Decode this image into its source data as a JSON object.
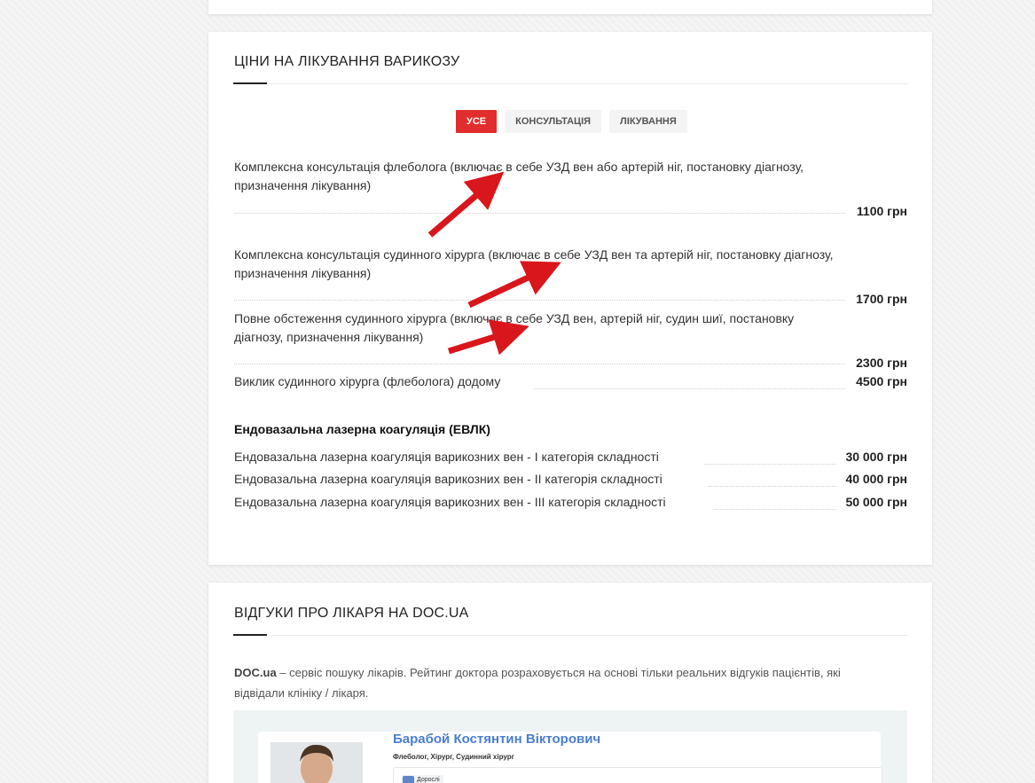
{
  "prices_section": {
    "title": "ЦІНИ НА ЛІКУВАННЯ ВАРИКОЗУ",
    "tabs": [
      {
        "label": "УСЕ",
        "active": true
      },
      {
        "label": "КОНСУЛЬТАЦІЯ",
        "active": false
      },
      {
        "label": "ЛІКУВАННЯ",
        "active": false
      }
    ],
    "items": [
      {
        "line1": "Комплексна консультація флеболога (включає в себе УЗД вен або артерій ніг, постановку діагнозу,",
        "line2": "призначення лікування)",
        "price": "1100 грн"
      },
      {
        "line1": "Комплексна консультація судинного хірурга (включає в себе УЗД вен та артерій ніг, постановку діагнозу,",
        "line2": "призначення лікування)",
        "price": "1700 грн"
      },
      {
        "line1": "Повне обстеження судинного хірурга (включає в себе УЗД вен, артерій ніг, судин шиї, постановку",
        "line2": "діагнозу, призначення лікування)",
        "price": "2300 грн"
      },
      {
        "line1": "Виклик судинного хірурга (флеболога) додому",
        "price": "4500 грн"
      }
    ],
    "evlk_heading": "Ендовазальна лазерна коагуляція (ЕВЛК)",
    "evlk_items": [
      {
        "label": "Ендовазальна лазерна коагуляція варикозних вен - І категорія складності",
        "price": "30 000 грн"
      },
      {
        "label": "Ендовазальна лазерна коагуляція варикозних вен - ІІ категорія складності",
        "price": "40 000 грн"
      },
      {
        "label": "Ендовазальна лазерна коагуляція варикозних вен - ІІІ категорія складності",
        "price": "50 000 грн"
      }
    ]
  },
  "reviews_section": {
    "title": "ВІДГУКИ ПРО ЛІКАРЯ НА DOC.UA",
    "desc_brand": "DOC.ua",
    "desc_line1": " – сервіс пошуку лікарів. Рейтинг доктора розраховується на основі тільки реальних відгуків пацієнтів, які",
    "desc_line2": "відвідали клініку / лікаря.",
    "doctor": {
      "name": "Барабой Костянтин Вікторович",
      "specialties": "Флеболог, Хірург, Судинний хірург",
      "badge": "Дорослі"
    }
  },
  "colors": {
    "accent": "#e12d2d",
    "arrow": "#d9161c",
    "doctor_name": "#4b7ecf"
  }
}
